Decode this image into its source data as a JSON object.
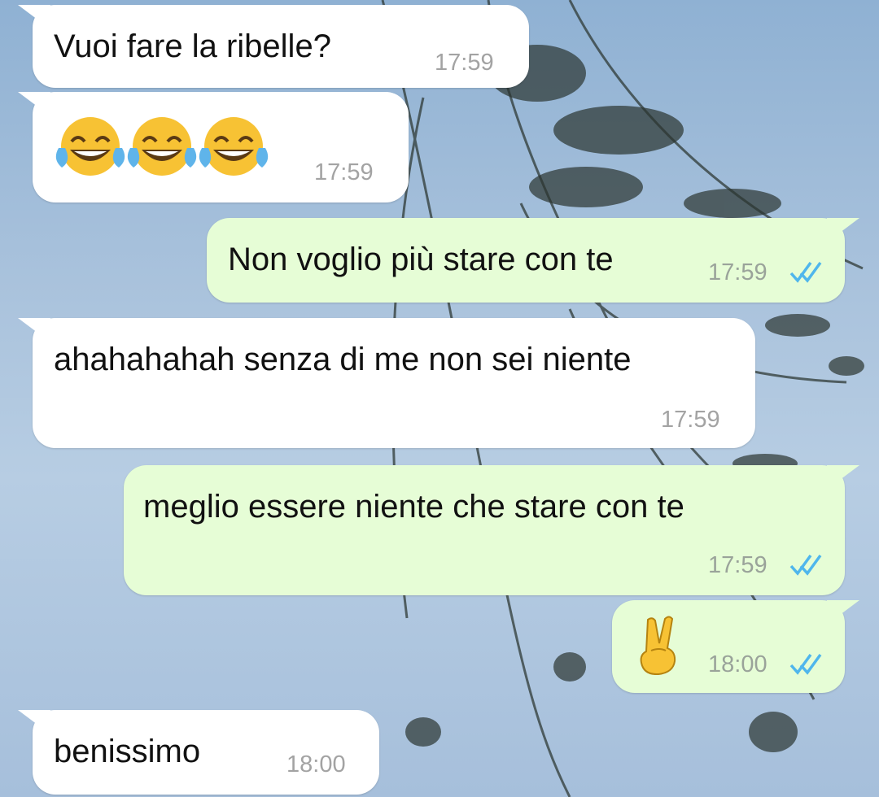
{
  "messages": [
    {
      "text": "Vuoi fare la ribelle?",
      "time": "17:59"
    },
    {
      "text": "",
      "emoji": [
        "face-with-tears-of-joy",
        "face-with-tears-of-joy",
        "face-with-tears-of-joy"
      ],
      "time": "17:59"
    },
    {
      "text": "Non voglio più stare con te",
      "time": "17:59",
      "status": "read"
    },
    {
      "text": "ahahahahah senza di me non sei niente",
      "time": "17:59"
    },
    {
      "text": "meglio essere niente che stare con te",
      "time": "17:59",
      "status": "read"
    },
    {
      "text": "",
      "emoji": [
        "victory-hand"
      ],
      "time": "18:00",
      "status": "read"
    },
    {
      "text": "benissimo",
      "time": "18:00"
    }
  ],
  "colors": {
    "incoming_bubble": "#ffffff",
    "outgoing_bubble": "#e6fdd6",
    "read_ticks": "#4fb6ec"
  }
}
